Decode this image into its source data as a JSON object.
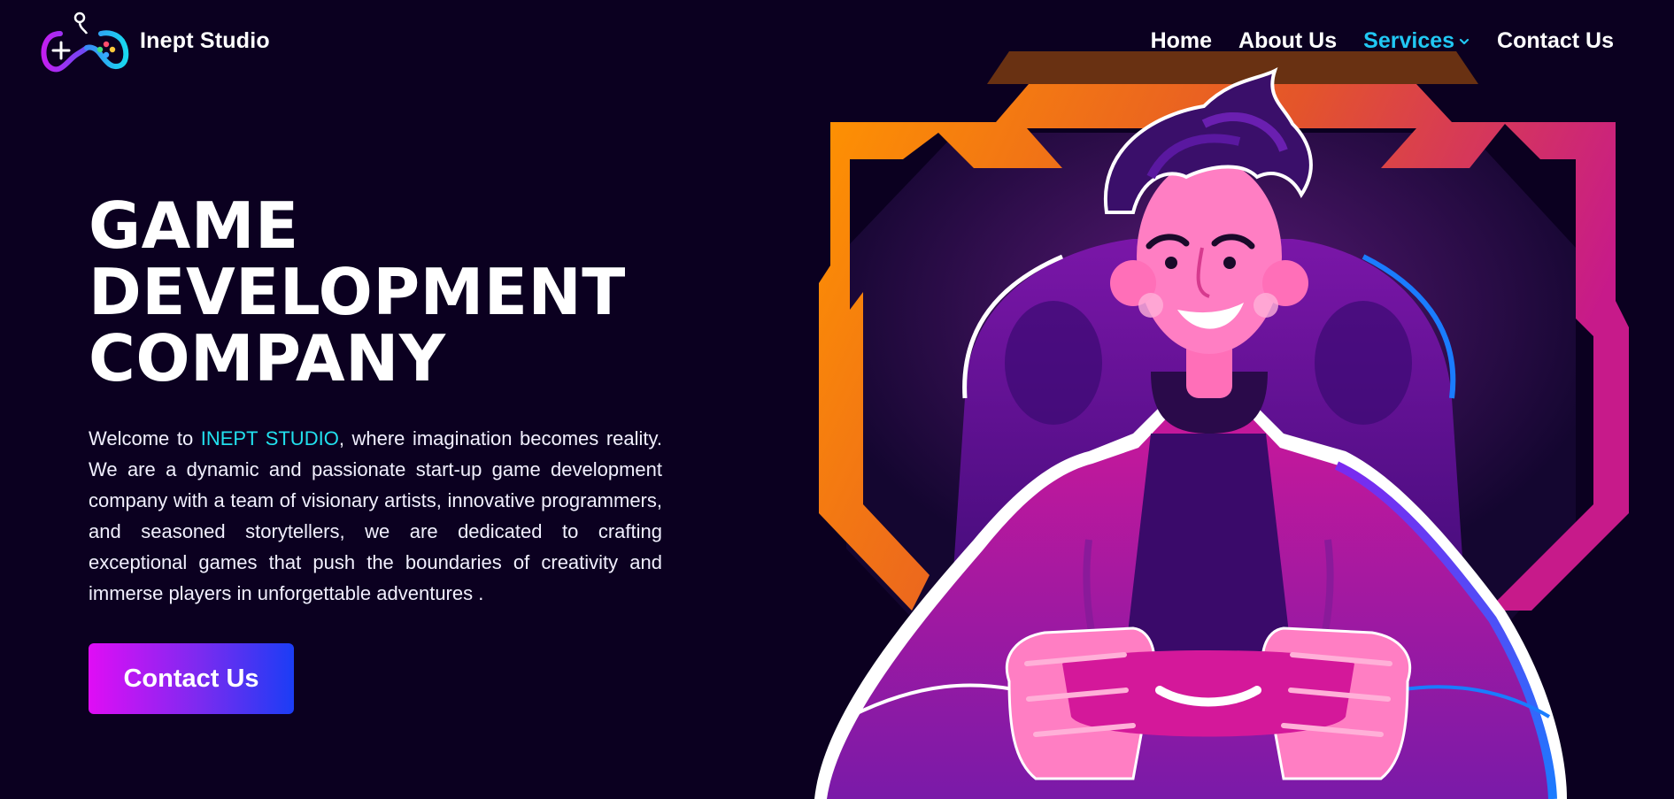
{
  "header": {
    "brand": "Inept Studio",
    "logo_icon": "gamepad-logo-icon",
    "nav": [
      {
        "label": "Home",
        "active": false
      },
      {
        "label": "About Us",
        "active": false
      },
      {
        "label": "Services",
        "active": true,
        "icon": "chevron-down-icon"
      },
      {
        "label": "Contact Us",
        "active": false
      }
    ]
  },
  "hero": {
    "title_lines": [
      "GAME",
      "DEVELOPMENT",
      "COMPANY"
    ],
    "intro_before": "Welcome to ",
    "intro_highlight": "INEPT STUDIO",
    "intro_after": ", where imagination becomes reality. We are a dynamic and passionate start-up game development company with a team of visionary artists, innovative programmers, and seasoned storytellers, we are dedicated to crafting exceptional games that push the boundaries of creativity and immerse players in unforgettable adventures .",
    "cta_label": "Contact Us"
  },
  "colors": {
    "background": "#0b0020",
    "accent_cyan": "#21c8f3",
    "highlight_cyan": "#22e0ee",
    "cta_gradient_start": "#e00df5",
    "cta_gradient_end": "#1b3df5",
    "frame_orange": "#ff8a00",
    "frame_pink": "#d4239a"
  },
  "illustration": {
    "icon": "gamer-with-controller-illustration"
  }
}
